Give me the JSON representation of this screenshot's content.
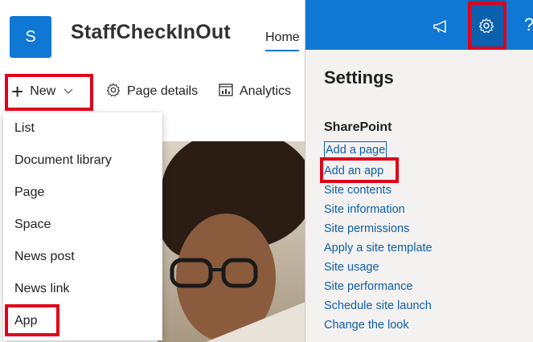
{
  "site": {
    "logo_letter": "S",
    "title": "StaffCheckInOut",
    "nav_home": "Home"
  },
  "commands": {
    "new": "New",
    "page_details": "Page details",
    "analytics": "Analytics"
  },
  "new_menu": {
    "items": [
      "List",
      "Document library",
      "Page",
      "Space",
      "News post",
      "News link",
      "App"
    ]
  },
  "settings": {
    "title": "Settings",
    "section": "SharePoint",
    "links": [
      "Add a page",
      "Add an app",
      "Site contents",
      "Site information",
      "Site permissions",
      "Apply a site template",
      "Site usage",
      "Site performance",
      "Schedule site launch",
      "Change the look"
    ]
  },
  "topbar": {
    "help_glyph": "?"
  },
  "colors": {
    "accent": "#0f78d4",
    "highlight": "#e0001b",
    "link": "#0f5ea8",
    "pane_bg": "#f3f2f1"
  }
}
